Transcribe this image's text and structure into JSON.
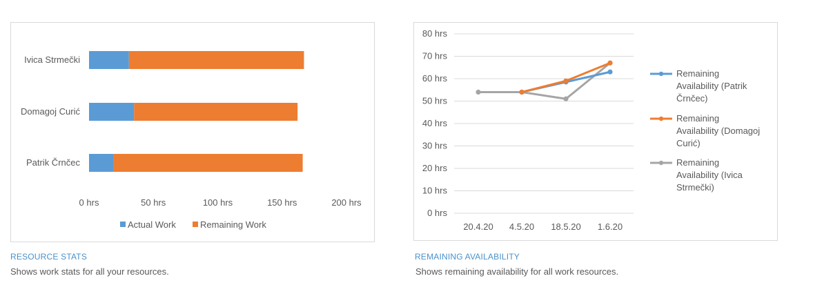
{
  "panels": {
    "resource_stats": {
      "title": "RESOURCE STATS",
      "description": "Shows work stats for all your resources."
    },
    "remaining_availability": {
      "title": "REMAINING AVAILABILITY",
      "description": "Shows remaining availability for all work resources."
    }
  },
  "chart_data": [
    {
      "type": "bar",
      "orientation": "horizontal",
      "stacked": true,
      "categories": [
        "Ivica Strmečki",
        "Domagoj Curić",
        "Patrik Črnčec"
      ],
      "series": [
        {
          "name": "Actual Work",
          "color": "#5b9bd5",
          "values": [
            31,
            35,
            19
          ]
        },
        {
          "name": "Remaining Work",
          "color": "#ed7d31",
          "values": [
            136,
            127,
            147
          ]
        }
      ],
      "xlim": [
        0,
        200
      ],
      "x_ticks": [
        "0 hrs",
        "50 hrs",
        "100 hrs",
        "150 hrs",
        "200 hrs"
      ],
      "x_tick_values": [
        0,
        50,
        100,
        150,
        200
      ],
      "legend_position": "bottom",
      "grid": false
    },
    {
      "type": "line",
      "x": [
        "20.4.20",
        "4.5.20",
        "18.5.20",
        "1.6.20"
      ],
      "ylim": [
        0,
        80
      ],
      "y_tick_values": [
        0,
        10,
        20,
        30,
        40,
        50,
        60,
        70,
        80
      ],
      "y_ticks": [
        "0 hrs",
        "10 hrs",
        "20 hrs",
        "30 hrs",
        "40 hrs",
        "50 hrs",
        "60 hrs",
        "70 hrs",
        "80 hrs"
      ],
      "series": [
        {
          "name": "Remaining Availability (Patrik Črnčec)",
          "legend_lines": [
            "Remaining",
            "Availability (Patrik",
            "Črnčec)"
          ],
          "color": "#5b9bd5",
          "values": [
            null,
            54,
            58.5,
            63
          ]
        },
        {
          "name": "Remaining Availability (Domagoj Curić)",
          "legend_lines": [
            "Remaining",
            "Availability (Domagoj",
            "Curić)"
          ],
          "color": "#ed7d31",
          "values": [
            null,
            54,
            59,
            67
          ]
        },
        {
          "name": "Remaining Availability (Ivica Strmečki)",
          "legend_lines": [
            "Remaining",
            "Availability (Ivica",
            "Strmečki)"
          ],
          "color": "#a5a5a5",
          "values": [
            54,
            54,
            51,
            67
          ]
        }
      ],
      "legend_position": "right",
      "grid": true
    }
  ]
}
